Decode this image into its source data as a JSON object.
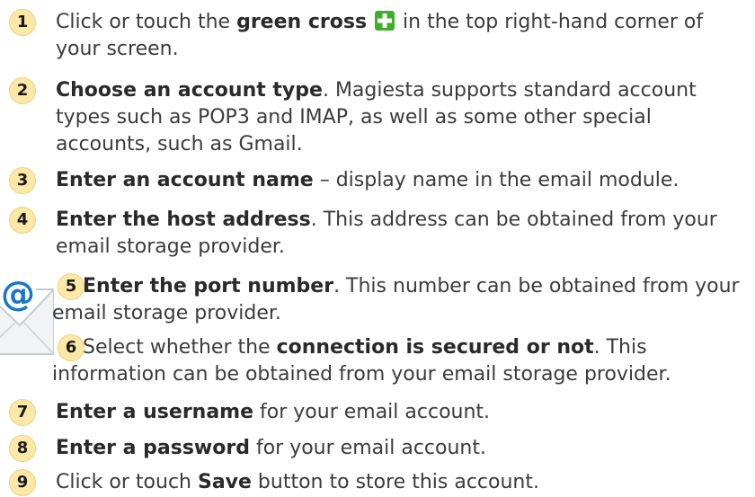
{
  "steps": [
    {
      "number": "1",
      "parts": [
        "Click or touch the ",
        "green cross",
        " in the top right-hand corner of your screen."
      ],
      "icon": "green-plus-icon"
    },
    {
      "number": "2",
      "parts": [
        "Choose an account type",
        ". Magiesta supports standard account types such as POP3 and IMAP, as well as some other special accounts, such as Gmail."
      ]
    },
    {
      "number": "3",
      "parts": [
        "Enter an account name",
        " – display name in the email module."
      ]
    },
    {
      "number": "4",
      "parts": [
        "Enter the host address",
        ". This address can be obtained from your email storage provider."
      ]
    },
    {
      "number": "5",
      "parts": [
        "Enter the port number",
        ". This number can be obtained from your email storage provider."
      ]
    },
    {
      "number": "6",
      "parts": [
        "Select whether the ",
        "connection is secured or not",
        ". This information can be obtained from your email storage provider."
      ]
    },
    {
      "number": "7",
      "parts": [
        "Enter a username",
        " for your email account."
      ]
    },
    {
      "number": "8",
      "parts": [
        "Enter a password",
        " for your email account."
      ]
    },
    {
      "number": "9",
      "parts": [
        "Click or touch ",
        "Save",
        " button to store this account."
      ]
    }
  ],
  "icons": {
    "add": "green-plus-icon",
    "email": "email-envelope-icon"
  },
  "colors": {
    "badge_fill": "#fde8a8",
    "plus_green": "#3fae2a",
    "at_blue": "#1a76c8"
  }
}
